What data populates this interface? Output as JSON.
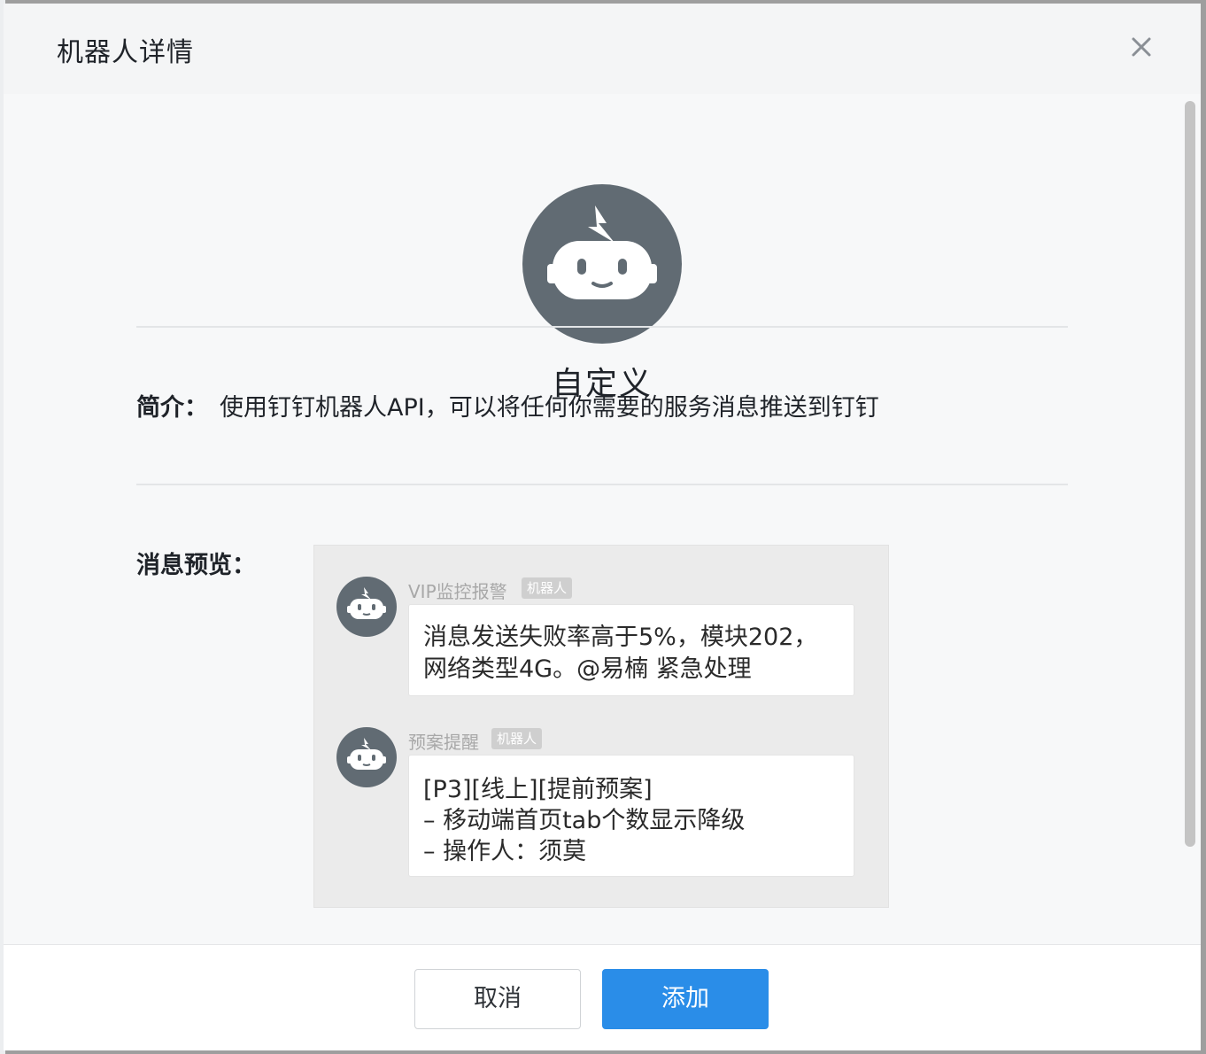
{
  "dialog": {
    "title": "机器人详情",
    "close_icon": "close-icon"
  },
  "robot": {
    "avatar_icon": "robot-icon",
    "name": "自定义"
  },
  "intro": {
    "label": "简介：",
    "text": "使用钉钉机器人API，可以将任何你需要的服务消息推送到钉钉"
  },
  "preview": {
    "label": "消息预览：",
    "messages": [
      {
        "sender": "VIP监控报警",
        "tag": "机器人",
        "lines": [
          "消息发送失败率高于5%，模块202，",
          "网络类型4G。@易楠 紧急处理"
        ]
      },
      {
        "sender": "预案提醒",
        "tag": "机器人",
        "lines": [
          "[P3][线上][提前预案]",
          "– 移动端首页tab个数显示降级",
          "– 操作人：须莫"
        ]
      }
    ]
  },
  "footer": {
    "cancel_label": "取消",
    "add_label": "添加"
  },
  "colors": {
    "primary": "#2a8de8",
    "avatar_bg": "#616b73"
  }
}
